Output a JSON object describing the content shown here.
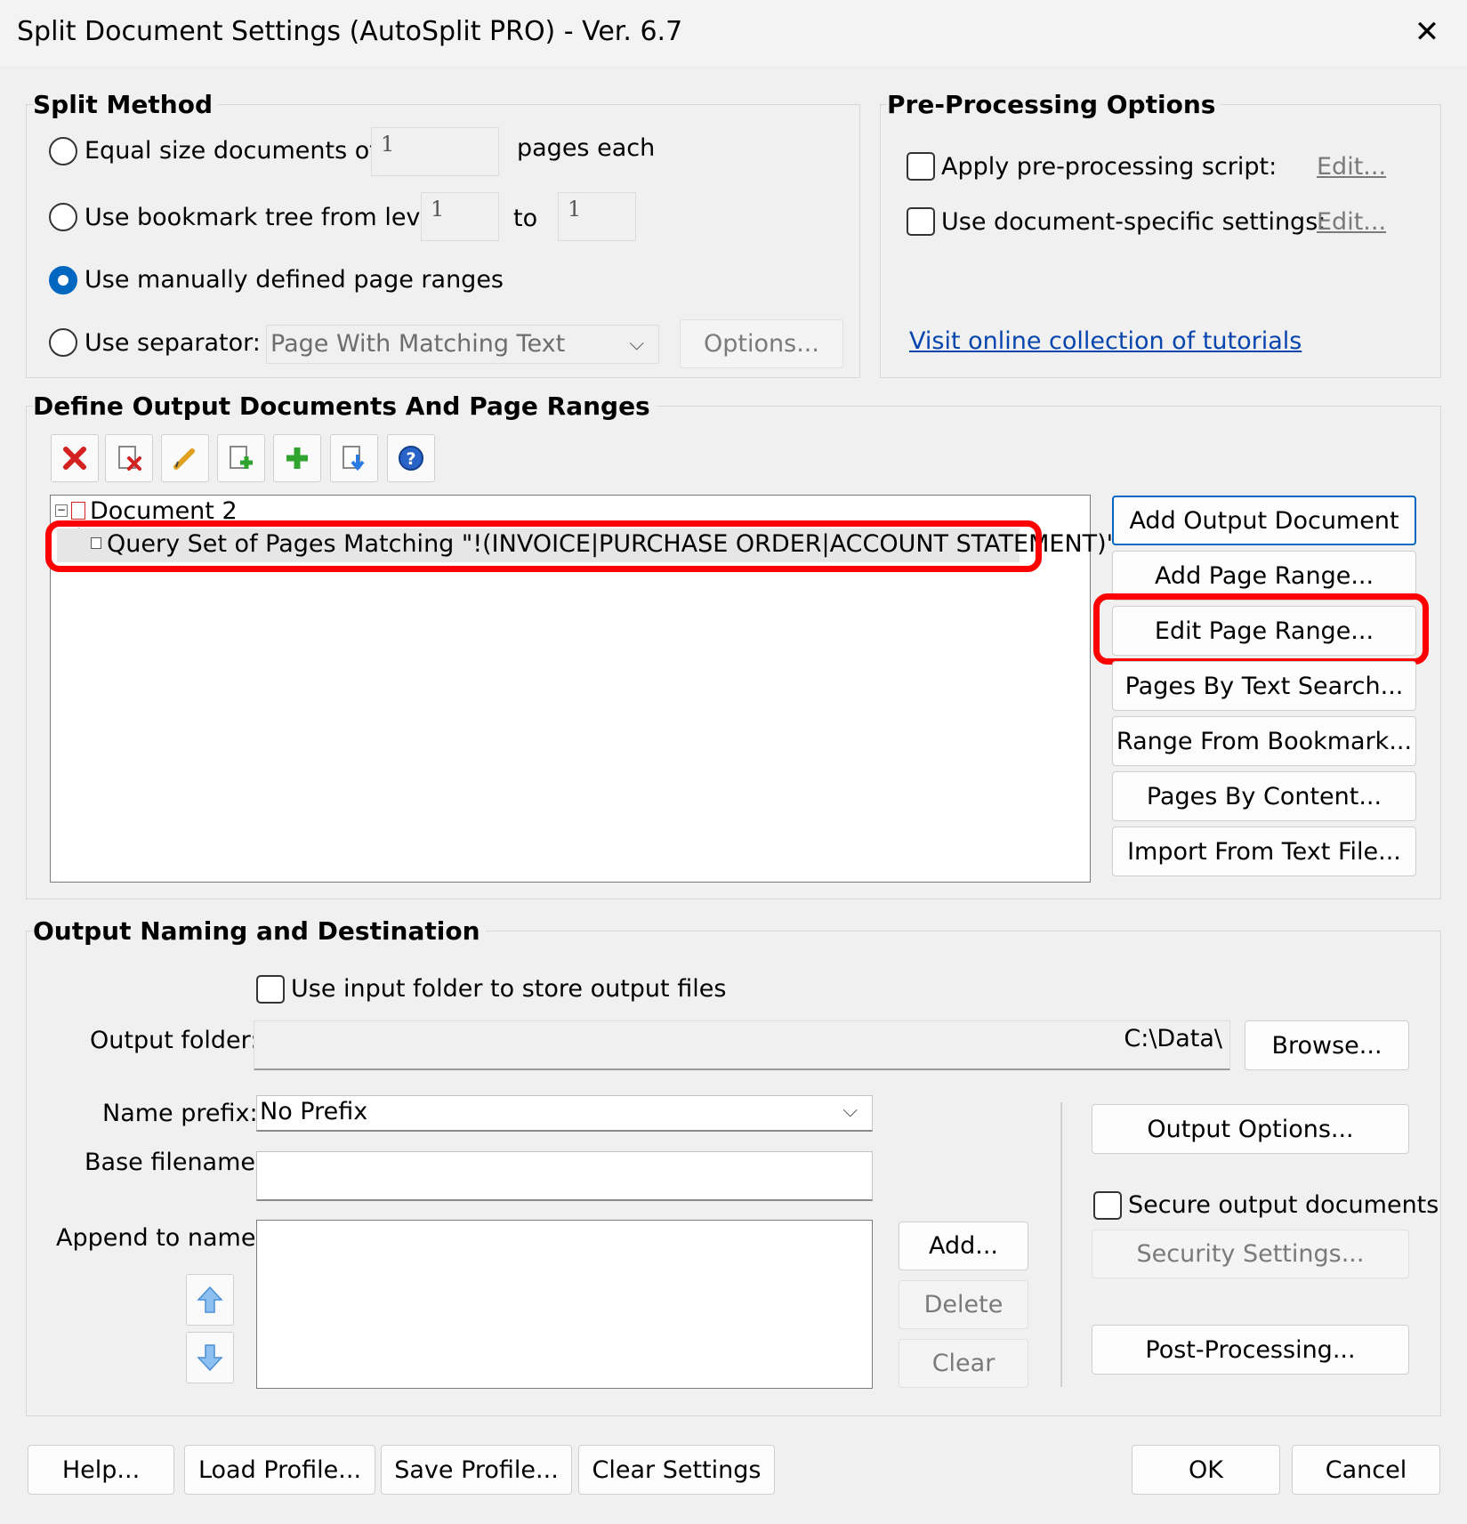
{
  "window": {
    "title": "Split Document Settings (AutoSplit PRO) - Ver. 6.7"
  },
  "split_method": {
    "title": "Split Method",
    "equal_size_label": "Equal size documents of",
    "equal_size_value": "1",
    "pages_each_label": "pages each",
    "bookmark_label": "Use bookmark tree from level",
    "bookmark_from": "1",
    "bookmark_to_label": "to",
    "bookmark_to": "1",
    "manual_label": "Use manually defined page ranges",
    "separator_label": "Use separator:",
    "separator_value": "Page With Matching Text",
    "options_label": "Options...",
    "selected": "manual"
  },
  "preprocessing": {
    "title": "Pre-Processing Options",
    "script_label": "Apply pre-processing script:",
    "script_edit": "Edit...",
    "docspecific_label": "Use document-specific settings:",
    "docspecific_edit": "Edit...",
    "tutorials_link": "Visit online collection of tutorials"
  },
  "output_docs": {
    "title": "Define Output Documents And Page Ranges",
    "toolbar_icons": [
      "delete-icon",
      "delete-document-icon",
      "edit-pencil-icon",
      "add-page-icon",
      "add-plus-icon",
      "import-icon",
      "help-icon"
    ],
    "tree": {
      "document": "Document 2",
      "range": "Query Set of Pages Matching \"!(INVOICE|PURCHASE ORDER|ACCOUNT STATEMENT)\""
    },
    "buttons": {
      "add_output": "Add Output Document",
      "add_range": "Add Page Range...",
      "edit_range": "Edit Page Range...",
      "text_search": "Pages By Text Search...",
      "from_bookmark": "Range From Bookmark...",
      "by_content": "Pages By Content...",
      "import_text": "Import From Text File..."
    }
  },
  "output_naming": {
    "title": "Output Naming and Destination",
    "use_input_folder_label": "Use input folder to store output files",
    "output_folder_label": "Output folder:",
    "output_folder_value": "C:\\Data\\",
    "browse_label": "Browse...",
    "name_prefix_label": "Name prefix:",
    "name_prefix_value": "No Prefix",
    "base_filename_label": "Base filename:",
    "base_filename_value": "",
    "append_label": "Append to name:",
    "add_label": "Add...",
    "delete_label": "Delete",
    "clear_label": "Clear",
    "output_options_label": "Output Options...",
    "secure_label": "Secure output documents",
    "security_settings_label": "Security Settings...",
    "post_processing_label": "Post-Processing..."
  },
  "footer": {
    "help": "Help...",
    "load_profile": "Load Profile...",
    "save_profile": "Save Profile...",
    "clear_settings": "Clear Settings",
    "ok": "OK",
    "cancel": "Cancel"
  },
  "colors": {
    "accent": "#0067c0",
    "highlight": "#ff0000",
    "link": "#0645ad"
  }
}
